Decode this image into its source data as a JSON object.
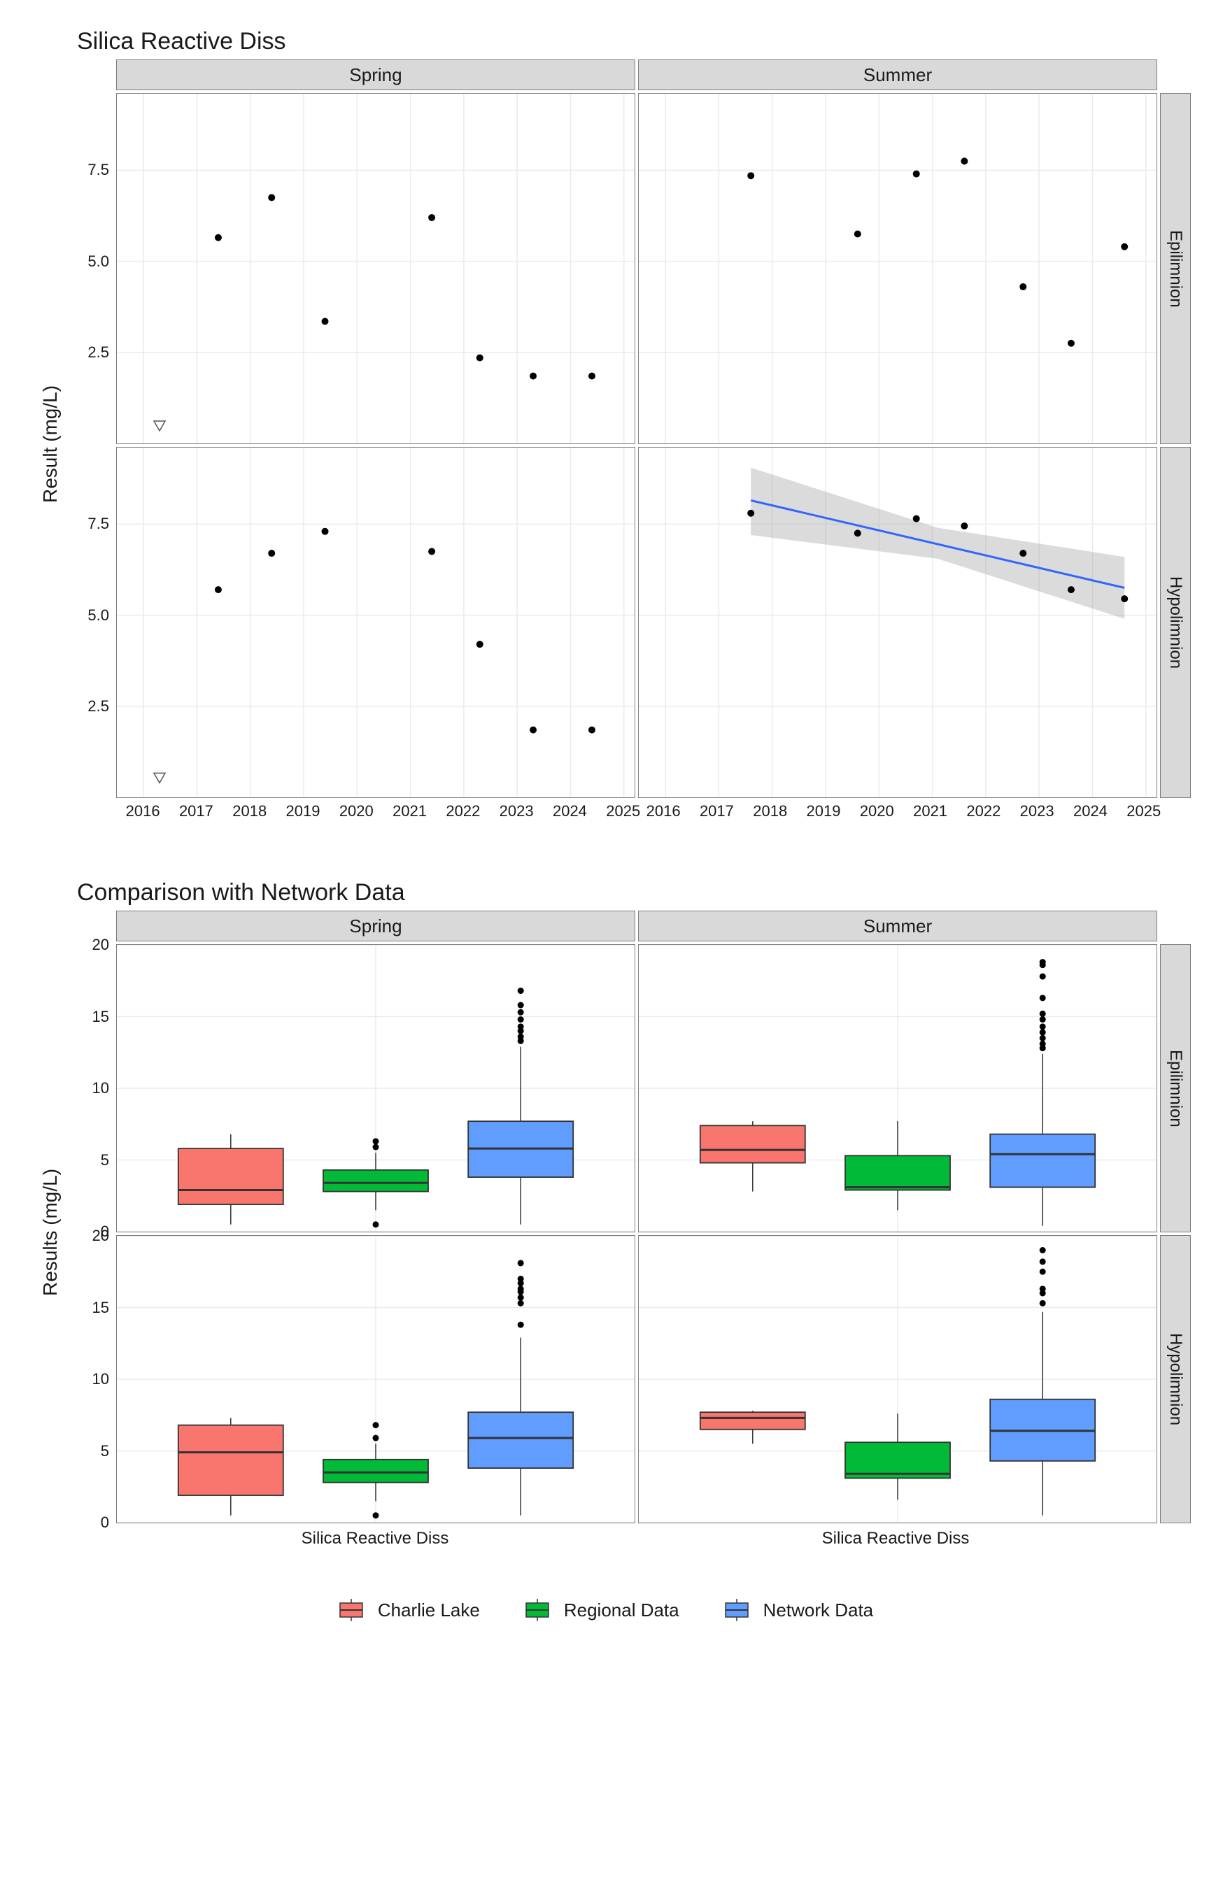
{
  "chart_data": [
    {
      "type": "scatter",
      "title": "Silica Reactive Diss",
      "xlabel": "",
      "ylabel": "Result (mg/L)",
      "xlim": [
        2015.5,
        2025.2
      ],
      "ylim": [
        0,
        9.6
      ],
      "y_ticks": [
        2.5,
        5.0,
        7.5
      ],
      "x_ticks": [
        2016,
        2017,
        2018,
        2019,
        2020,
        2021,
        2022,
        2023,
        2024,
        2025
      ],
      "facet_cols": [
        "Spring",
        "Summer"
      ],
      "facet_rows": [
        "Epilimnion",
        "Hypolimnion"
      ],
      "panels": {
        "Spring_Epilimnion": {
          "points": [
            {
              "x": 2017.4,
              "y": 5.65
            },
            {
              "x": 2018.4,
              "y": 6.75
            },
            {
              "x": 2019.4,
              "y": 3.35
            },
            {
              "x": 2021.4,
              "y": 6.2
            },
            {
              "x": 2022.3,
              "y": 2.35
            },
            {
              "x": 2023.3,
              "y": 1.85
            },
            {
              "x": 2024.4,
              "y": 1.85
            }
          ],
          "nd_points": [
            {
              "x": 2016.3,
              "y": 0.5
            }
          ]
        },
        "Summer_Epilimnion": {
          "points": [
            {
              "x": 2017.6,
              "y": 7.35
            },
            {
              "x": 2019.6,
              "y": 5.75
            },
            {
              "x": 2020.7,
              "y": 7.4
            },
            {
              "x": 2021.6,
              "y": 7.75
            },
            {
              "x": 2022.7,
              "y": 4.3
            },
            {
              "x": 2023.6,
              "y": 2.75
            },
            {
              "x": 2024.6,
              "y": 5.4
            }
          ]
        },
        "Spring_Hypolimnion": {
          "points": [
            {
              "x": 2017.4,
              "y": 5.7
            },
            {
              "x": 2018.4,
              "y": 6.7
            },
            {
              "x": 2019.4,
              "y": 7.3
            },
            {
              "x": 2021.4,
              "y": 6.75
            },
            {
              "x": 2022.3,
              "y": 4.2
            },
            {
              "x": 2023.3,
              "y": 1.85
            },
            {
              "x": 2024.4,
              "y": 1.85
            }
          ],
          "nd_points": [
            {
              "x": 2016.3,
              "y": 0.55
            }
          ]
        },
        "Summer_Hypolimnion": {
          "points": [
            {
              "x": 2017.6,
              "y": 7.8
            },
            {
              "x": 2019.6,
              "y": 7.25
            },
            {
              "x": 2020.7,
              "y": 7.65
            },
            {
              "x": 2021.6,
              "y": 7.45
            },
            {
              "x": 2022.7,
              "y": 6.7
            },
            {
              "x": 2023.6,
              "y": 5.7
            },
            {
              "x": 2024.6,
              "y": 5.45
            }
          ],
          "trend": {
            "x0": 2017.6,
            "y0": 8.15,
            "x1": 2024.6,
            "y1": 5.75
          },
          "ribbon": {
            "x0": 2017.6,
            "y0_lo": 7.2,
            "y0_hi": 9.05,
            "x1": 2024.6,
            "y1_lo": 4.9,
            "y1_hi": 6.6,
            "mid_lo": 6.55,
            "mid_hi": 7.4
          }
        }
      }
    },
    {
      "type": "boxplot",
      "title": "Comparison with Network Data",
      "xlabel": "",
      "ylabel": "Results (mg/L)",
      "ylim": [
        0,
        20
      ],
      "y_ticks": [
        0,
        5,
        10,
        15,
        20
      ],
      "facet_cols": [
        "Spring",
        "Summer"
      ],
      "facet_rows": [
        "Epilimnion",
        "Hypolimnion"
      ],
      "category_label": "Silica Reactive Diss",
      "series_colors": {
        "Charlie Lake": "#f8766d",
        "Regional Data": "#00ba38",
        "Network Data": "#619cff"
      },
      "panels": {
        "Spring_Epilimnion": {
          "boxes": [
            {
              "series": "Charlie Lake",
              "min": 0.5,
              "q1": 1.9,
              "median": 2.9,
              "q3": 5.8,
              "max": 6.8,
              "outliers": []
            },
            {
              "series": "Regional Data",
              "min": 1.5,
              "q1": 2.8,
              "median": 3.4,
              "q3": 4.3,
              "max": 5.5,
              "outliers": [
                0.5,
                5.9,
                6.3
              ]
            },
            {
              "series": "Network Data",
              "min": 0.5,
              "q1": 3.8,
              "median": 5.8,
              "q3": 7.7,
              "max": 12.9,
              "outliers": [
                13.3,
                13.6,
                14.0,
                14.3,
                14.8,
                15.3,
                15.8,
                16.8
              ]
            }
          ]
        },
        "Summer_Epilimnion": {
          "boxes": [
            {
              "series": "Charlie Lake",
              "min": 2.8,
              "q1": 4.8,
              "median": 5.7,
              "q3": 7.4,
              "max": 7.7,
              "outliers": []
            },
            {
              "series": "Regional Data",
              "min": 1.5,
              "q1": 2.9,
              "median": 3.1,
              "q3": 5.3,
              "max": 7.7,
              "outliers": []
            },
            {
              "series": "Network Data",
              "min": 0.4,
              "q1": 3.1,
              "median": 5.4,
              "q3": 6.8,
              "max": 12.4,
              "outliers": [
                12.8,
                13.1,
                13.5,
                13.9,
                14.3,
                14.8,
                15.2,
                16.3,
                17.8,
                18.6,
                18.8
              ]
            }
          ]
        },
        "Spring_Hypolimnion": {
          "boxes": [
            {
              "series": "Charlie Lake",
              "min": 0.5,
              "q1": 1.9,
              "median": 4.9,
              "q3": 6.8,
              "max": 7.3,
              "outliers": []
            },
            {
              "series": "Regional Data",
              "min": 1.5,
              "q1": 2.8,
              "median": 3.5,
              "q3": 4.4,
              "max": 5.5,
              "outliers": [
                0.5,
                5.9,
                6.8
              ]
            },
            {
              "series": "Network Data",
              "min": 0.5,
              "q1": 3.8,
              "median": 5.9,
              "q3": 7.7,
              "max": 12.9,
              "outliers": [
                13.8,
                15.3,
                15.7,
                16.1,
                16.3,
                16.7,
                17.0,
                18.1
              ]
            }
          ]
        },
        "Summer_Hypolimnion": {
          "boxes": [
            {
              "series": "Charlie Lake",
              "min": 5.5,
              "q1": 6.5,
              "median": 7.3,
              "q3": 7.7,
              "max": 7.8,
              "outliers": []
            },
            {
              "series": "Regional Data",
              "min": 1.6,
              "q1": 3.1,
              "median": 3.4,
              "q3": 5.6,
              "max": 7.6,
              "outliers": []
            },
            {
              "series": "Network Data",
              "min": 0.5,
              "q1": 4.3,
              "median": 6.4,
              "q3": 8.6,
              "max": 14.7,
              "outliers": [
                15.3,
                16.0,
                16.3,
                17.5,
                18.2,
                19.0
              ]
            }
          ]
        }
      },
      "legend": [
        "Charlie Lake",
        "Regional Data",
        "Network Data"
      ]
    }
  ],
  "labels": {
    "top_title": "Silica Reactive Diss",
    "bottom_title": "Comparison with Network Data",
    "spring": "Spring",
    "summer": "Summer",
    "epi": "Epilimnion",
    "hypo": "Hypolimnion",
    "result": "Result (mg/L)",
    "results": "Results (mg/L)",
    "cat": "Silica Reactive Diss",
    "legend1": "Charlie Lake",
    "legend2": "Regional Data",
    "legend3": "Network Data"
  }
}
